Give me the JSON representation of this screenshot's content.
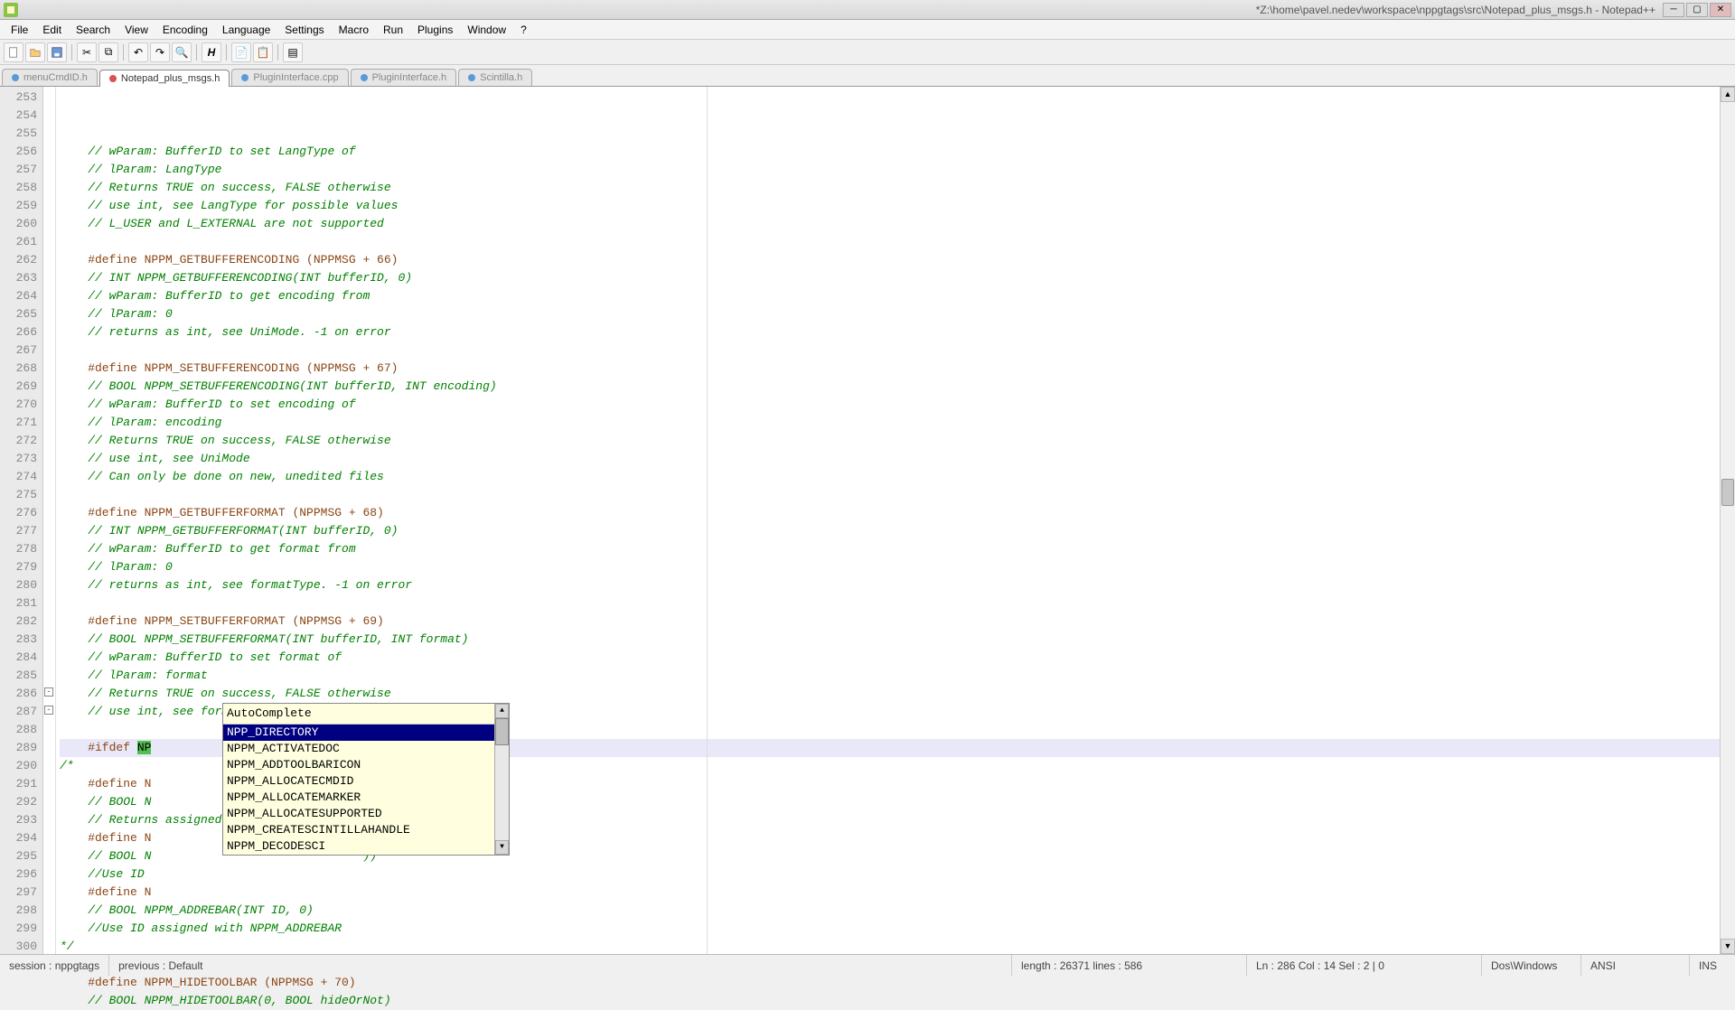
{
  "title": "*Z:\\home\\pavel.nedev\\workspace\\nppgtags\\src\\Notepad_plus_msgs.h - Notepad++",
  "menu": [
    "File",
    "Edit",
    "Search",
    "View",
    "Encoding",
    "Language",
    "Settings",
    "Macro",
    "Run",
    "Plugins",
    "Window",
    "?"
  ],
  "tabs": [
    {
      "label": "menuCmdID.h",
      "active": false
    },
    {
      "label": "Notepad_plus_msgs.h",
      "active": true
    },
    {
      "label": "PluginInterface.cpp",
      "active": false
    },
    {
      "label": "PluginInterface.h",
      "active": false
    },
    {
      "label": "Scintilla.h",
      "active": false
    }
  ],
  "first_line": 253,
  "lines": [
    {
      "t": "    // wParam: BufferID to set LangType of",
      "c": "comment"
    },
    {
      "t": "    // lParam: LangType",
      "c": "comment"
    },
    {
      "t": "    // Returns TRUE on success, FALSE otherwise",
      "c": "comment"
    },
    {
      "t": "    // use int, see LangType for possible values",
      "c": "comment"
    },
    {
      "t": "    // L_USER and L_EXTERNAL are not supported",
      "c": "comment"
    },
    {
      "t": "",
      "c": ""
    },
    {
      "t": "    #define NPPM_GETBUFFERENCODING (NPPMSG + 66)",
      "c": "preproc"
    },
    {
      "t": "    // INT NPPM_GETBUFFERENCODING(INT bufferID, 0)",
      "c": "comment"
    },
    {
      "t": "    // wParam: BufferID to get encoding from",
      "c": "comment"
    },
    {
      "t": "    // lParam: 0",
      "c": "comment"
    },
    {
      "t": "    // returns as int, see UniMode. -1 on error",
      "c": "comment"
    },
    {
      "t": "",
      "c": ""
    },
    {
      "t": "    #define NPPM_SETBUFFERENCODING (NPPMSG + 67)",
      "c": "preproc"
    },
    {
      "t": "    // BOOL NPPM_SETBUFFERENCODING(INT bufferID, INT encoding)",
      "c": "comment"
    },
    {
      "t": "    // wParam: BufferID to set encoding of",
      "c": "comment"
    },
    {
      "t": "    // lParam: encoding",
      "c": "comment"
    },
    {
      "t": "    // Returns TRUE on success, FALSE otherwise",
      "c": "comment"
    },
    {
      "t": "    // use int, see UniMode",
      "c": "comment"
    },
    {
      "t": "    // Can only be done on new, unedited files",
      "c": "comment"
    },
    {
      "t": "",
      "c": ""
    },
    {
      "t": "    #define NPPM_GETBUFFERFORMAT (NPPMSG + 68)",
      "c": "preproc"
    },
    {
      "t": "    // INT NPPM_GETBUFFERFORMAT(INT bufferID, 0)",
      "c": "comment"
    },
    {
      "t": "    // wParam: BufferID to get format from",
      "c": "comment"
    },
    {
      "t": "    // lParam: 0",
      "c": "comment"
    },
    {
      "t": "    // returns as int, see formatType. -1 on error",
      "c": "comment"
    },
    {
      "t": "",
      "c": ""
    },
    {
      "t": "    #define NPPM_SETBUFFERFORMAT (NPPMSG + 69)",
      "c": "preproc"
    },
    {
      "t": "    // BOOL NPPM_SETBUFFERFORMAT(INT bufferID, INT format)",
      "c": "comment"
    },
    {
      "t": "    // wParam: BufferID to set format of",
      "c": "comment"
    },
    {
      "t": "    // lParam: format",
      "c": "comment"
    },
    {
      "t": "    // Returns TRUE on success, FALSE otherwise",
      "c": "comment"
    },
    {
      "t": "    // use int, see formatType",
      "c": "comment"
    },
    {
      "t": "",
      "c": ""
    },
    {
      "t": "    #ifdef ",
      "c": "preproc",
      "token": "NP",
      "hl": true
    },
    {
      "t": "/*",
      "c": "comment"
    },
    {
      "t": "    #define N",
      "c": "preproc"
    },
    {
      "t": "    // BOOL N",
      "c": "comment"
    },
    {
      "t": "    // Returns assigned ID in wID value of struct pointer",
      "c": "comment"
    },
    {
      "t": "    #define N",
      "c": "preproc"
    },
    {
      "t": "    // BOOL N                              ))",
      "c": "comment"
    },
    {
      "t": "    //Use ID",
      "c": "comment"
    },
    {
      "t": "    #define N",
      "c": "preproc"
    },
    {
      "t": "    // BOOL NPPM_ADDREBAR(INT ID, 0)",
      "c": "comment"
    },
    {
      "t": "    //Use ID assigned with NPPM_ADDREBAR",
      "c": "comment"
    },
    {
      "t": "*/",
      "c": "comment"
    },
    {
      "t": "",
      "c": ""
    },
    {
      "t": "    #define NPPM_HIDETOOLBAR (NPPMSG + 70)",
      "c": "preproc"
    },
    {
      "t": "    // BOOL NPPM_HIDETOOLBAR(0, BOOL hideOrNot)",
      "c": "comment"
    }
  ],
  "autocomplete": {
    "title": "AutoComplete",
    "items": [
      {
        "label": "NPP_DIRECTORY",
        "selected": true
      },
      {
        "label": "NPPM_ACTIVATEDOC"
      },
      {
        "label": "NPPM_ADDTOOLBARICON"
      },
      {
        "label": "NPPM_ALLOCATECMDID"
      },
      {
        "label": "NPPM_ALLOCATEMARKER"
      },
      {
        "label": "NPPM_ALLOCATESUPPORTED"
      },
      {
        "label": "NPPM_CREATESCINTILLAHANDLE"
      },
      {
        "label": "NPPM_DECODESCI"
      }
    ]
  },
  "status": {
    "session": "session : nppgtags",
    "previous": "previous : Default",
    "length": "length : 26371   lines : 586",
    "pos": "Ln : 286   Col : 14   Sel : 2 | 0",
    "eol": "Dos\\Windows",
    "enc": "ANSI",
    "ins": "INS"
  }
}
